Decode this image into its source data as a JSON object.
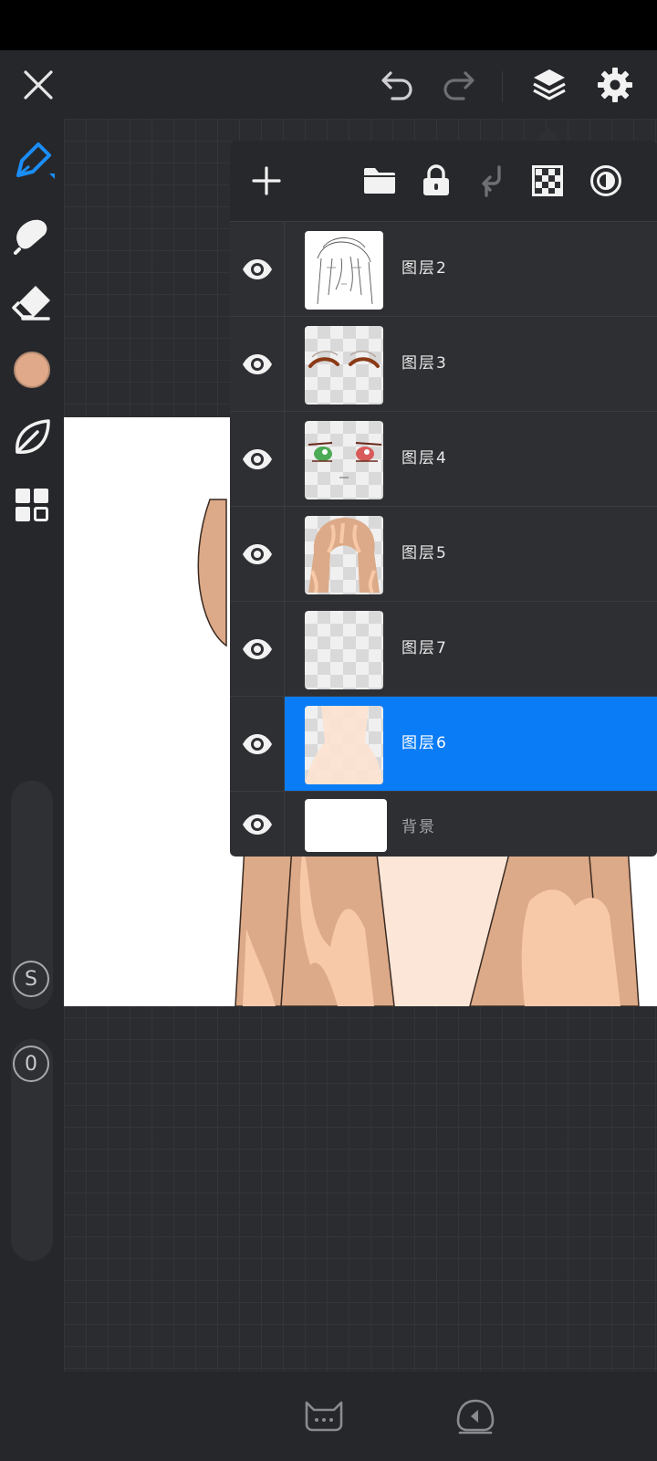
{
  "layers": [
    {
      "name": "图层2"
    },
    {
      "name": "图层3"
    },
    {
      "name": "图层4"
    },
    {
      "name": "图层5"
    },
    {
      "name": "图层7"
    },
    {
      "name": "图层6",
      "selected": true
    },
    {
      "name": "背景"
    }
  ],
  "slider_labels": {
    "size": "S",
    "opacity": "0"
  },
  "colors": {
    "accent": "#0a7cf5",
    "current_color": "#e0aa8a",
    "panel_bg": "#2e2f33",
    "toolbar_bg": "#26272b"
  },
  "icons": {
    "close": "close-icon",
    "undo": "undo-icon",
    "redo": "redo-icon",
    "layers": "layers-icon",
    "settings": "gear-icon",
    "pen": "pen-icon",
    "smudge": "smudge-icon",
    "eraser": "eraser-icon",
    "leaf": "leaf-icon",
    "grid": "grid-icon",
    "add_layer": "plus-icon",
    "folder": "folder-icon",
    "lock": "lock-icon",
    "merge_down": "merge-down-icon",
    "transparency": "checkerboard-icon",
    "blend": "blend-mode-icon",
    "visibility": "eye-icon"
  }
}
